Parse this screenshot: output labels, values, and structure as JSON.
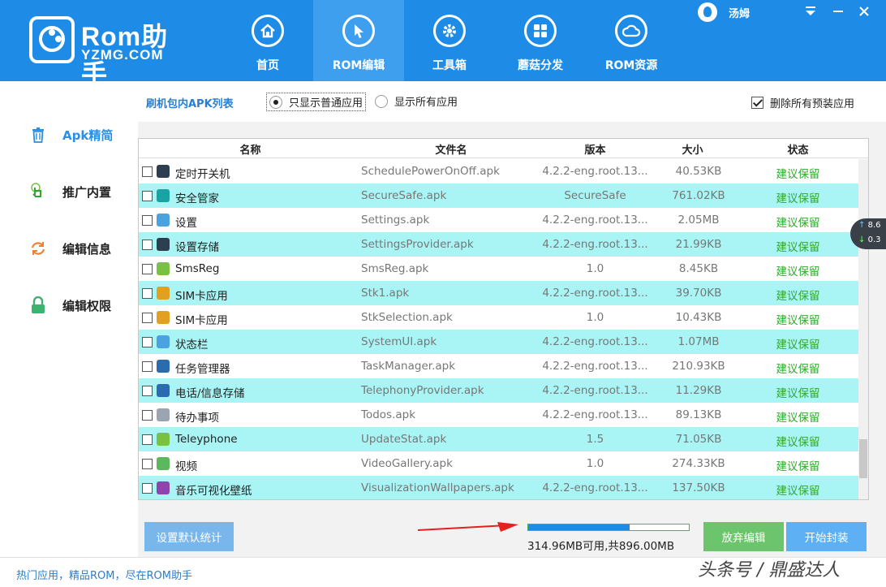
{
  "app": {
    "logo_title": "Rom助手",
    "logo_sub": "YZMG.COM"
  },
  "nav": [
    {
      "label": "首页",
      "icon": "home-icon",
      "active": false
    },
    {
      "label": "ROM编辑",
      "icon": "cursor-icon",
      "active": true
    },
    {
      "label": "工具箱",
      "icon": "gear-icon",
      "active": false
    },
    {
      "label": "蘑菇分发",
      "icon": "grid-icon",
      "active": false
    },
    {
      "label": "ROM资源",
      "icon": "cloud-icon",
      "active": false
    }
  ],
  "user": {
    "name": "汤姆"
  },
  "sidebar": {
    "items": [
      {
        "label": "Apk精简",
        "icon": "trash-icon",
        "active": true
      },
      {
        "label": "推广内置",
        "icon": "hand-icon",
        "active": false
      },
      {
        "label": "编辑信息",
        "icon": "refresh-icon",
        "active": false
      },
      {
        "label": "编辑权限",
        "icon": "lock-icon",
        "active": false
      }
    ]
  },
  "filter": {
    "title": "刷机包内APK列表",
    "radio_normal": "只显示普通应用",
    "radio_all": "显示所有应用",
    "delete_preinstalled": "删除所有预装应用"
  },
  "table": {
    "headers": {
      "name": "名称",
      "file": "文件名",
      "version": "版本",
      "size": "大小",
      "status": "状态"
    },
    "rows": [
      {
        "name": "定时开关机",
        "file": "SchedulePowerOnOff.apk",
        "version": "4.2.2-eng.root.13...",
        "size": "40.53KB",
        "status": "建议保留",
        "icon_color": "#2c3e50"
      },
      {
        "name": "安全管家",
        "file": "SecureSafe.apk",
        "version": "SecureSafe",
        "size": "761.02KB",
        "status": "建议保留",
        "icon_color": "#1aa3a3"
      },
      {
        "name": "设置",
        "file": "Settings.apk",
        "version": "4.2.2-eng.root.13...",
        "size": "2.05MB",
        "status": "建议保留",
        "icon_color": "#4aa3df"
      },
      {
        "name": "设置存储",
        "file": "SettingsProvider.apk",
        "version": "4.2.2-eng.root.13...",
        "size": "21.99KB",
        "status": "建议保留",
        "icon_color": "#2c3e50"
      },
      {
        "name": "SmsReg",
        "file": "SmsReg.apk",
        "version": "1.0",
        "size": "8.45KB",
        "status": "建议保留",
        "icon_color": "#7ac142"
      },
      {
        "name": "SIM卡应用",
        "file": "Stk1.apk",
        "version": "4.2.2-eng.root.13...",
        "size": "39.70KB",
        "status": "建议保留",
        "icon_color": "#e0a020"
      },
      {
        "name": "SIM卡应用",
        "file": "StkSelection.apk",
        "version": "1.0",
        "size": "10.43KB",
        "status": "建议保留",
        "icon_color": "#e0a020"
      },
      {
        "name": "状态栏",
        "file": "SystemUI.apk",
        "version": "4.2.2-eng.root.13...",
        "size": "1.07MB",
        "status": "建议保留",
        "icon_color": "#4aa3df"
      },
      {
        "name": "任务管理器",
        "file": "TaskManager.apk",
        "version": "4.2.2-eng.root.13...",
        "size": "210.93KB",
        "status": "建议保留",
        "icon_color": "#2b6cb0"
      },
      {
        "name": "电话/信息存储",
        "file": "TelephonyProvider.apk",
        "version": "4.2.2-eng.root.13...",
        "size": "11.29KB",
        "status": "建议保留",
        "icon_color": "#2b6cb0"
      },
      {
        "name": "待办事项",
        "file": "Todos.apk",
        "version": "4.2.2-eng.root.13...",
        "size": "89.13KB",
        "status": "建议保留",
        "icon_color": "#9aa5b1"
      },
      {
        "name": "Teleyphone",
        "file": "UpdateStat.apk",
        "version": "1.5",
        "size": "71.05KB",
        "status": "建议保留",
        "icon_color": "#7ac142"
      },
      {
        "name": "视频",
        "file": "VideoGallery.apk",
        "version": "1.0",
        "size": "274.33KB",
        "status": "建议保留",
        "icon_color": "#5cb85c"
      },
      {
        "name": "音乐可视化壁纸",
        "file": "VisualizationWallpapers.apk",
        "version": "4.2.2-eng.root.13...",
        "size": "137.50KB",
        "status": "建议保留",
        "icon_color": "#8e44ad"
      }
    ]
  },
  "net": {
    "up": "8.6",
    "down": "0.3"
  },
  "actions": {
    "stat_button": "设置默认统计",
    "discard_button": "放弃编辑",
    "pack_button": "开始封装",
    "storage_text": "314.96MB可用,共896.00MB",
    "storage_fraction": 0.63
  },
  "footer": {
    "text": "热门应用，精品ROM，尽在ROM助手",
    "watermark": "头条号 / 鼎盛达人"
  }
}
